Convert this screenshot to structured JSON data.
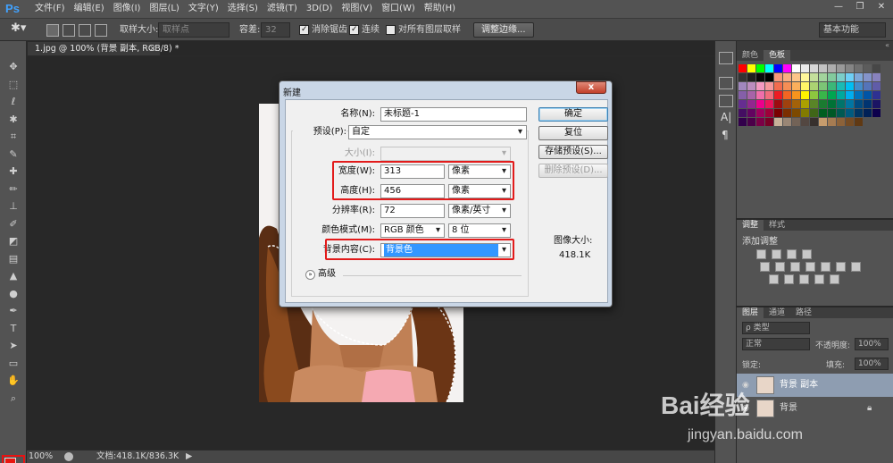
{
  "app": {
    "name": "Ps"
  },
  "menubar": {
    "items": [
      "文件(F)",
      "编辑(E)",
      "图像(I)",
      "图层(L)",
      "文字(Y)",
      "选择(S)",
      "滤镜(T)",
      "3D(D)",
      "视图(V)",
      "窗口(W)",
      "帮助(H)"
    ],
    "minimize": "—",
    "restore": "❐"
  },
  "options_bar": {
    "sample_size_label": "取样大小:",
    "sample_size_value": "取样点",
    "tolerance_label": "容差:",
    "tolerance_value": "32",
    "antialias_label": "消除锯齿",
    "antialias_checked": true,
    "contiguous_label": "连续",
    "contiguous_checked": true,
    "sample_all_label": "对所有图层取样",
    "sample_all_checked": false,
    "refine_edge_button": "调整边缘...",
    "workspace_value": "基本功能"
  },
  "document": {
    "tab_title": "1.jpg @ 100% (背景 副本, RGB/8) *",
    "zoom": "100%",
    "doc_size": "文档:418.1K/836.3K"
  },
  "tool_icons": [
    "move-icon",
    "marquee-icon",
    "lasso-icon",
    "magic-wand-icon",
    "crop-icon",
    "eyedropper-icon",
    "healing-brush-icon",
    "brush-icon",
    "clone-stamp-icon",
    "history-brush-icon",
    "eraser-icon",
    "gradient-icon",
    "blur-icon",
    "dodge-icon",
    "pen-icon",
    "type-icon",
    "path-selection-icon",
    "rectangle-icon",
    "hand-icon",
    "zoom-icon"
  ],
  "colors": {
    "foreground": "#e8160f",
    "background": "#1a6fd1"
  },
  "dialog": {
    "title": "新建",
    "close_label": "x",
    "name_label": "名称(N):",
    "name_value": "未标题-1",
    "preset_label": "预设(P):",
    "preset_value": "自定",
    "size_label": "大小(I):",
    "size_value": "",
    "width_label": "宽度(W):",
    "width_value": "313",
    "width_unit": "像素",
    "height_label": "高度(H):",
    "height_value": "456",
    "height_unit": "像素",
    "resolution_label": "分辨率(R):",
    "resolution_value": "72",
    "resolution_unit": "像素/英寸",
    "color_mode_label": "颜色模式(M):",
    "color_mode_value": "RGB 颜色",
    "bit_depth_value": "8 位",
    "background_label": "背景内容(C):",
    "background_value": "背景色",
    "advanced_label": "高级",
    "image_size_label": "图像大小:",
    "image_size_value": "418.1K",
    "buttons": {
      "ok": "确定",
      "reset": "复位",
      "save_preset": "存储预设(S)...",
      "delete_preset": "删除预设(D)..."
    }
  },
  "swatches_panel": {
    "tabs": [
      "颜色",
      "色板"
    ],
    "active_tab": "色板",
    "colors": [
      "#ff0000",
      "#ffff00",
      "#00ff00",
      "#00ffff",
      "#0000ff",
      "#ff00ff",
      "#ffffff",
      "#ebebeb",
      "#d6d6d6",
      "#c2c2c2",
      "#adadad",
      "#999999",
      "#858585",
      "#707070",
      "#5c5c5c",
      "#474747",
      "#333333",
      "#1f1f1f",
      "#0a0a0a",
      "#000000",
      "#f7977a",
      "#f9ad81",
      "#fdc68a",
      "#fff79a",
      "#c4df9b",
      "#a2d39c",
      "#82ca9d",
      "#7bcdc8",
      "#6ecff6",
      "#7ea7d8",
      "#8493ca",
      "#8882be",
      "#a187be",
      "#bc8dbf",
      "#f49ac2",
      "#f6989d",
      "#f26c4f",
      "#f68e55",
      "#fbaf5c",
      "#fff467",
      "#acd372",
      "#7cc576",
      "#3bb878",
      "#1abbb4",
      "#00bff3",
      "#438cca",
      "#5574b9",
      "#605ca8",
      "#855fa8",
      "#a763a8",
      "#f06eaa",
      "#f26d7d",
      "#ed1c24",
      "#f26522",
      "#f7941d",
      "#fff200",
      "#8dc73f",
      "#39b54a",
      "#00a651",
      "#00a99d",
      "#00aeef",
      "#0072bc",
      "#0054a6",
      "#2e3192",
      "#662d91",
      "#92278f",
      "#ec008c",
      "#ed145b",
      "#9e0b0f",
      "#a0410d",
      "#a36209",
      "#aba000",
      "#598527",
      "#1a7b30",
      "#007236",
      "#00746b",
      "#0076a3",
      "#004b80",
      "#003471",
      "#1b1464",
      "#440e62",
      "#630460",
      "#9e005d",
      "#9e0039",
      "#790000",
      "#7b2e00",
      "#7d4900",
      "#827b00",
      "#406618",
      "#005e20",
      "#005826",
      "#005952",
      "#005b7f",
      "#003663",
      "#002157",
      "#0d004c",
      "#32004b",
      "#4b0049",
      "#7b0046",
      "#7a0026",
      "#c7b299",
      "#998675",
      "#736357",
      "#534741",
      "#37302d",
      "#c69c6d",
      "#a67c52",
      "#8c6239",
      "#754c24",
      "#603913"
    ]
  },
  "adjustments_panel": {
    "tabs": [
      "调整",
      "样式"
    ],
    "active_tab": "调整",
    "subtitle": "添加调整"
  },
  "layers_panel": {
    "tabs": [
      "图层",
      "通道",
      "路径"
    ],
    "active_tab": "图层",
    "filter_label": "ρ 类型",
    "blend_mode": "正常",
    "opacity_label": "不透明度:",
    "opacity_value": "100%",
    "lock_label": "锁定:",
    "fill_label": "填充:",
    "fill_value": "100%",
    "layers": [
      {
        "name": "背景 副本",
        "selected": true
      },
      {
        "name": "背景",
        "selected": false
      }
    ]
  },
  "watermark": {
    "text": "Bai经验",
    "url": "jingyan.baidu.com"
  }
}
